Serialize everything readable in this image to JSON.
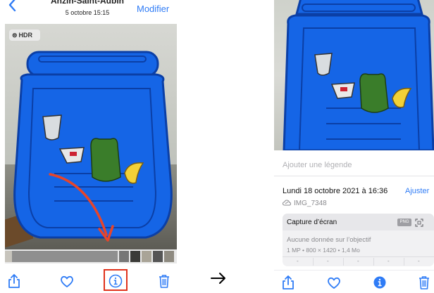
{
  "left_screen": {
    "header": {
      "place": "Anzin-Saint-Aubin",
      "date_time": "5 octobre  15:15",
      "modifier_label": "Modifier"
    },
    "badge": {
      "label": "HDR",
      "icon": "hdr-icon"
    },
    "toolbar": {
      "icons": [
        "share-icon",
        "heart-icon",
        "info-icon",
        "trash-icon"
      ],
      "highlighted": "info-icon",
      "highlight_color": "#e0321c"
    },
    "annotation_arrow_color": "#e8452a"
  },
  "transition_arrow": "→",
  "right_screen": {
    "caption_placeholder": "Ajouter une légende",
    "date_line": "Lundi 18 octobre 2021 à 16:36",
    "adjust_label": "Ajuster",
    "file_name": "IMG_7348",
    "card": {
      "title": "Capture d’écran",
      "format_badge": "PNG",
      "lens_text": "Aucune donnée sur l’objectif",
      "specs_text": "1 MP  •  800 × 1420  •  1,4 Mo",
      "columns": [
        "-",
        "-",
        "-",
        "-",
        "-"
      ]
    },
    "toolbar": {
      "icons": [
        "share-icon",
        "heart-icon",
        "info-filled-icon",
        "trash-icon"
      ]
    }
  },
  "colors": {
    "accent": "#2f7cf6",
    "bin": "#1565e6",
    "bin_dark": "#0b3fa6"
  }
}
